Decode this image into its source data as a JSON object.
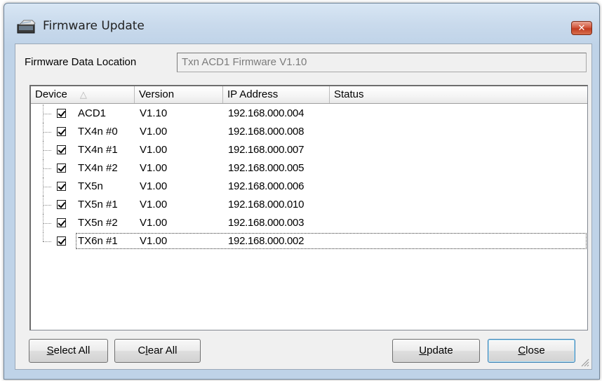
{
  "window": {
    "title": "Firmware Update",
    "icon": "firmware-app-icon",
    "close_glyph": "✕"
  },
  "location": {
    "label": "Firmware Data Location",
    "value": "Txn ACD1 Firmware V1.10"
  },
  "list": {
    "columns": [
      "Device",
      "Version",
      "IP Address",
      "Status"
    ],
    "sort_indicator": "△",
    "rows": [
      {
        "device": "ACD1",
        "version": "V1.10",
        "ip": "192.168.000.004",
        "status": "",
        "checked": true
      },
      {
        "device": "TX4n #0",
        "version": "V1.00",
        "ip": "192.168.000.008",
        "status": "",
        "checked": true
      },
      {
        "device": "TX4n #1",
        "version": "V1.00",
        "ip": "192.168.000.007",
        "status": "",
        "checked": true
      },
      {
        "device": "TX4n #2",
        "version": "V1.00",
        "ip": "192.168.000.005",
        "status": "",
        "checked": true
      },
      {
        "device": "TX5n",
        "version": "V1.00",
        "ip": "192.168.000.006",
        "status": "",
        "checked": true
      },
      {
        "device": "TX5n #1",
        "version": "V1.00",
        "ip": "192.168.000.010",
        "status": "",
        "checked": true
      },
      {
        "device": "TX5n #2",
        "version": "V1.00",
        "ip": "192.168.000.003",
        "status": "",
        "checked": true
      },
      {
        "device": "TX6n #1",
        "version": "V1.00",
        "ip": "192.168.000.002",
        "status": "",
        "checked": true
      }
    ],
    "selected_index": 7
  },
  "buttons": {
    "select_all": {
      "pre": "",
      "mnemonic": "S",
      "post": "elect All"
    },
    "clear_all": {
      "pre": "C",
      "mnemonic": "l",
      "post": "ear All"
    },
    "update": {
      "pre": "",
      "mnemonic": "U",
      "post": "pdate"
    },
    "close": {
      "pre": "",
      "mnemonic": "C",
      "post": "lose"
    }
  }
}
